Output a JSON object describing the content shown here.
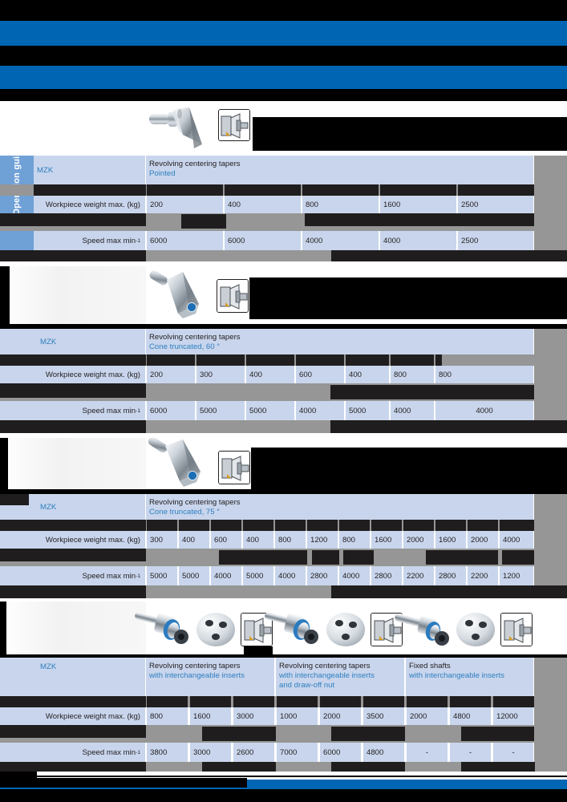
{
  "side_tab": {
    "label": "Operation guide"
  },
  "common": {
    "mzk_label": "MZK",
    "weight_label": "Workpiece weight max. (kg)",
    "speed_label": "Speed max min",
    "speed_sup": "-1",
    "dash": "-"
  },
  "colors": {
    "brand_blue": "#0066b3",
    "tab_blue": "#6fa0d6",
    "cell_blue": "#c8d5ec",
    "accent_text": "#2f7fc1",
    "gray_band": "#969696",
    "redaction": "#000000"
  },
  "sections": [
    {
      "id": "pointed",
      "mzk": "MZK",
      "title_line1": "Revolving centering tapers",
      "title_line2": "Pointed",
      "weight_label": "Workpiece weight max. (kg)",
      "speed_label": "Speed max min",
      "weights": [
        "200",
        "400",
        "800",
        "1600",
        "2500"
      ],
      "speeds": [
        "6000",
        "6000",
        "4000",
        "4000",
        "2500"
      ],
      "columns": 5,
      "icon": "revolving-centering-taper-pointed"
    },
    {
      "id": "cone60",
      "mzk": "MZK",
      "title_line1": "Revolving centering tapers",
      "title_line2": "Cone truncated, 60 °",
      "weight_label": "Workpiece weight max. (kg)",
      "speed_label": "Speed max min",
      "weights": [
        "200",
        "300",
        "400",
        "600",
        "400",
        "800",
        "800"
      ],
      "speeds": [
        "6000",
        "5000",
        "5000",
        "4000",
        "5000",
        "4000",
        "4000"
      ],
      "columns": 7,
      "icon": "revolving-centering-taper-cone-60"
    },
    {
      "id": "cone75",
      "mzk": "MZK",
      "title_line1": "Revolving centering tapers",
      "title_line2": "Cone truncated, 75 °",
      "weight_label": "Workpiece weight max. (kg)",
      "speed_label": "Speed max min",
      "weights": [
        "300",
        "400",
        "600",
        "400",
        "800",
        "1200",
        "800",
        "1600",
        "2000",
        "1600",
        "2000",
        "4000"
      ],
      "speeds": [
        "5000",
        "5000",
        "4000",
        "5000",
        "4000",
        "2800",
        "4000",
        "2800",
        "2200",
        "2800",
        "2200",
        "1200"
      ],
      "columns": 12,
      "icon": "revolving-centering-taper-cone-75"
    },
    {
      "id": "interchangeable",
      "mzk": "MZK",
      "weight_label": "Workpiece weight max. (kg)",
      "speed_label": "Speed max min",
      "groups": [
        {
          "title_line1": "Revolving centering tapers",
          "title_line2": "with interchangeable inserts",
          "title_line3": "",
          "weights": [
            "800",
            "1600",
            "3000"
          ],
          "speeds": [
            "3800",
            "3000",
            "2600"
          ]
        },
        {
          "title_line1": "Revolving centering tapers",
          "title_line2": "with interchangeable inserts",
          "title_line3": "and draw-off nut",
          "weights": [
            "1000",
            "2000",
            "3500"
          ],
          "speeds": [
            "7000",
            "6000",
            "4800"
          ]
        },
        {
          "title_line1": "Fixed shafts",
          "title_line2": "with interchangeable inserts",
          "title_line3": "",
          "weights": [
            "2000",
            "4800",
            "12000"
          ],
          "speeds": [
            "-",
            "-",
            "-"
          ]
        }
      ],
      "icon": "revolving-centering-taper-interchangeable-inserts"
    }
  ]
}
